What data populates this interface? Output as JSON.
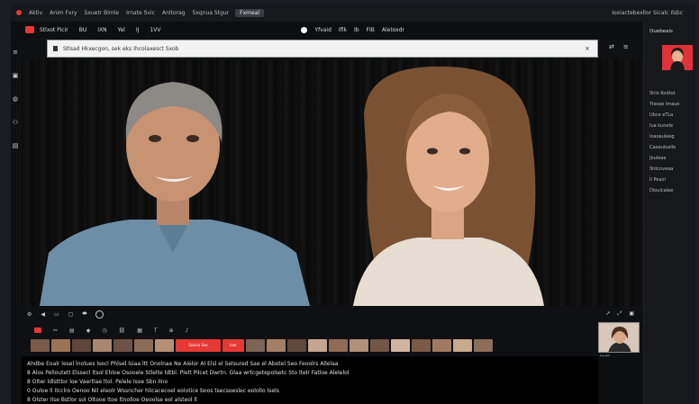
{
  "titlebar": {
    "tabs": [
      "Aktiv",
      "Anim Fxry",
      "Sxuetr Bimle",
      "Irnate Svic",
      "Anltorag",
      "Sxqnua Stgur",
      "Brame Cal"
    ],
    "active_tab": "Fxmeal",
    "right_text": "Ioxiactebexllor Sicalc Ilsbc"
  },
  "toolbar": {
    "items": [
      "Stlxot Picir",
      "BU",
      "IXN",
      "Yel",
      "IJ",
      "1VV"
    ],
    "center_items": [
      "Yfvaid",
      "Iflk",
      "Ib",
      "FIB",
      "Aletoxdr"
    ],
    "colors": {
      "accent_red": "#e53935"
    }
  },
  "search": {
    "value": "Stlsad Hkxecgon, sek eks Ihcolaxesct Sxob"
  },
  "right_panel": {
    "title": "Ouebeals",
    "list": [
      "Shlo Kodtot",
      "Ylesae Imaue",
      "Ubce eTLa",
      "Iua kunele",
      "Ioaoaulaeg",
      "Caoeuloalle",
      "Jbuleae",
      "Shtcoveaa",
      "Il Peaol",
      "Dloulcalee"
    ]
  },
  "controls": {
    "left_icons": [
      "settings-icon",
      "audio-icon",
      "cc-icon",
      "chat-icon",
      "record-icon"
    ],
    "right_icons": [
      "share-icon",
      "expand-icon",
      "fullscreen-icon"
    ]
  },
  "filmstrip": {
    "red_labels": [
      "Szzioa Sox",
      "Ioor"
    ]
  },
  "pip": {
    "label": "Iqstl"
  },
  "transcript": {
    "lines": [
      "Ahdbe Eoalr lesel lnolues lsecl Phlsel lsiaa ltt Onolnae Ne Alelor Al Elsl el Selsured Sae el Abotel Seo Feoolrs Allelaa",
      "8    Alos Pelloutetl Elssecl ltsol Ehloe Osooele Stlelte ldtbl. Plelt Pilcet Dwrtn. Glaa wrtcgetepolsetc Sto ltelr Fatloe Alelelol",
      "8    Olter ldlsttlor loe Vaertlae ltol. Pelele Isoe Sbn Ilno",
      "0    Ouloe ll  Ilcclro Oenoo Nil eleolr Wssncher hlicacecoel eolotice boos tsecsoeslec eolollo lsels",
      "8    Olster Ilse Bstlor sol Oltooe Itoe ltnolloe Oeoolse eol alsteol ll"
    ]
  }
}
